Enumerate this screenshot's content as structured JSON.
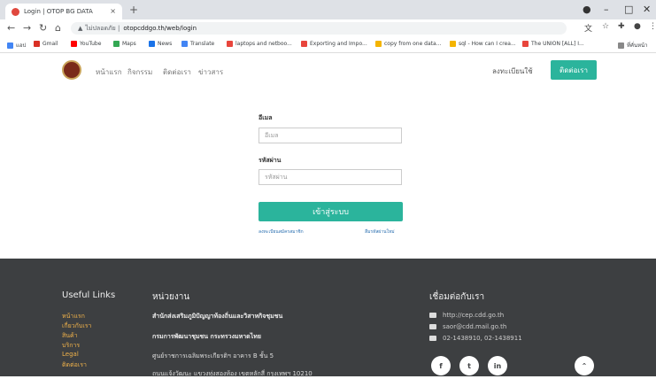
{
  "browser": {
    "tab_title": "Login | OTOP BG DATA",
    "tab_close": "×",
    "new_tab": "+",
    "url_prefix": "ไม่ปลอดภัย |",
    "url": "otopcddgo.th/web/login",
    "bookmarks": [
      {
        "label": "แอป",
        "color": "#4285f4"
      },
      {
        "label": "Gmail",
        "color": "#d93025"
      },
      {
        "label": "YouTube",
        "color": "#ff0000"
      },
      {
        "label": "Maps",
        "color": "#34a853"
      },
      {
        "label": "News",
        "color": "#1a73e8"
      },
      {
        "label": "Translate",
        "color": "#4285f4"
      },
      {
        "label": "laptops and netboo...",
        "color": "#e8453c"
      },
      {
        "label": "Exporting and Impo...",
        "color": "#e8453c"
      },
      {
        "label": "copy from one data...",
        "color": "#f4b400"
      },
      {
        "label": "sql - How can I crea...",
        "color": "#f4b400"
      },
      {
        "label": "The UNION [ALL] I...",
        "color": "#e8453c"
      },
      {
        "label": "ที่คั่นหน้า",
        "color": "#888888"
      }
    ]
  },
  "site": {
    "nav": [
      "หน้าแรก",
      "กิจกรรม",
      "ติดต่อเรา",
      "ข่าวสาร"
    ],
    "register": "ลงทะเบียนใช้",
    "contact_button": "ติดต่อเรา"
  },
  "login": {
    "email_label": "อีเมล",
    "email_placeholder": "อีเมล",
    "password_label": "รหัสผ่าน",
    "password_placeholder": "รหัสผ่าน",
    "submit": "เข้าสู่ระบบ",
    "signup_link": "ลงทะเบียนสมัครสมาชิก",
    "forgot_link": "ลืมรหัสผ่านใหม่"
  },
  "footer": {
    "useful_title": "Useful Links",
    "useful_links": [
      "หน้าแรก",
      "เกี่ยวกับเรา",
      "สินค้า",
      "บริการ",
      "Legal",
      "ติดต่อเรา"
    ],
    "agency_title": "หน่วยงาน",
    "agency_lines": [
      "สำนักส่งเสริมภูมิปัญญาท้องถิ่นและวิสาหกิจชุมชน",
      "กรมการพัฒนาชุมชน กระทรวงมหาดไทย",
      "ศูนย์ราชการเฉลิมพระเกียรติฯ อาคาร B ชั้น 5",
      "ถนนแจ้งวัฒนะ แขวงทุ่งสองห้อง เขตหลักสี่ กรุงเทพฯ 10210"
    ],
    "contact_title": "เชื่อมต่อกับเรา",
    "contact_lines": [
      "http://cep.cdd.go.th",
      "saor@cdd.mail.go.th",
      "02-1438910, 02-1438911"
    ],
    "social": [
      "f",
      "t",
      "in"
    ]
  }
}
